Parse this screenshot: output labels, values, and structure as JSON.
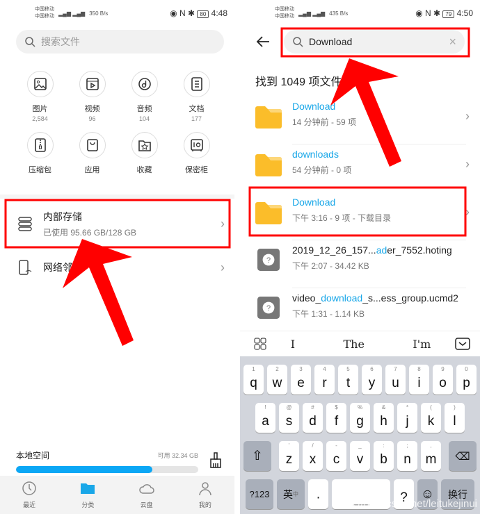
{
  "left": {
    "status": {
      "carrier1": "中国移动",
      "carrier2": "中国移动",
      "speed": "350 B/s",
      "battery": "80",
      "time": "4:48"
    },
    "search_placeholder": "搜索文件",
    "categories": [
      {
        "label": "图片",
        "count": "2,584",
        "icon": "image-icon"
      },
      {
        "label": "视频",
        "count": "96",
        "icon": "video-icon"
      },
      {
        "label": "音频",
        "count": "104",
        "icon": "music-icon"
      },
      {
        "label": "文档",
        "count": "177",
        "icon": "document-icon"
      },
      {
        "label": "压缩包",
        "icon": "archive-icon"
      },
      {
        "label": "应用",
        "icon": "app-bag-icon"
      },
      {
        "label": "收藏",
        "icon": "favorite-folder-icon"
      },
      {
        "label": "保密柜",
        "icon": "safe-icon"
      }
    ],
    "internal_storage": {
      "title": "内部存储",
      "usage": "已使用 95.66 GB/128 GB"
    },
    "network": {
      "title": "网络邻居"
    },
    "local_space": {
      "label": "本地空间",
      "available": "可用 32.34 GB",
      "used_fraction": 0.747
    },
    "nav": [
      {
        "label": "最近"
      },
      {
        "label": "分类",
        "active": true
      },
      {
        "label": "云盘"
      },
      {
        "label": "我的"
      }
    ]
  },
  "right": {
    "status": {
      "carrier1": "中国移动",
      "carrier2": "中国移动",
      "speed": "435 B/s",
      "battery": "79",
      "time": "4:50"
    },
    "search_value": "Download",
    "result_count": "找到 1049 项文件",
    "results": [
      {
        "name_hl": "Download",
        "name_rest": "",
        "meta": "14 分钟前 - 59 项",
        "type": "folder"
      },
      {
        "name_hl": "downloads",
        "name_rest": "",
        "meta": "54 分钟前 - 0 项",
        "type": "folder"
      },
      {
        "name_hl": "Download",
        "name_rest": "",
        "meta": "下午 3:16  - 9 项 - 下载目录",
        "type": "folder"
      },
      {
        "name_pre": "2019_12_26_157...",
        "name_hl": "ad",
        "name_rest": "er_7552.hoting",
        "meta": "下午 2:07  - 34.42 KB",
        "type": "unknown"
      },
      {
        "name_pre": "video_",
        "name_hl": "download",
        "name_rest": "_s...ess_group.ucmd2",
        "meta": "下午 1:31  - 1.14 KB",
        "type": "unknown"
      }
    ],
    "suggestions": [
      "I",
      "The",
      "I'm"
    ],
    "keyboard": {
      "row1": [
        [
          "q",
          "1"
        ],
        [
          "w",
          "2"
        ],
        [
          "e",
          "3"
        ],
        [
          "r",
          "4"
        ],
        [
          "t",
          "5"
        ],
        [
          "y",
          "6"
        ],
        [
          "u",
          "7"
        ],
        [
          "i",
          "8"
        ],
        [
          "o",
          "9"
        ],
        [
          "p",
          "0"
        ]
      ],
      "row2": [
        [
          "a",
          "!"
        ],
        [
          "s",
          "@"
        ],
        [
          "d",
          "#"
        ],
        [
          "f",
          "$"
        ],
        [
          "g",
          "%"
        ],
        [
          "h",
          "&"
        ],
        [
          "j",
          "*"
        ],
        [
          "k",
          "("
        ],
        [
          "l",
          ")"
        ]
      ],
      "row3": [
        [
          "z",
          "'"
        ],
        [
          "x",
          "/"
        ],
        [
          "c",
          "-"
        ],
        [
          "v",
          "_"
        ],
        [
          "b",
          ":"
        ],
        [
          "n",
          ";"
        ],
        [
          "m",
          ","
        ]
      ],
      "sym": "?123",
      "lang": "英",
      "lang_sub": "中",
      "dot": "·",
      "question": "?",
      "enter": "换行"
    },
    "watermark": "https://blog.csdn.net/leitukejinui"
  },
  "colors": {
    "accent": "#19a7e8",
    "folder": "#fbbd2a",
    "annotation": "#ff0000"
  }
}
